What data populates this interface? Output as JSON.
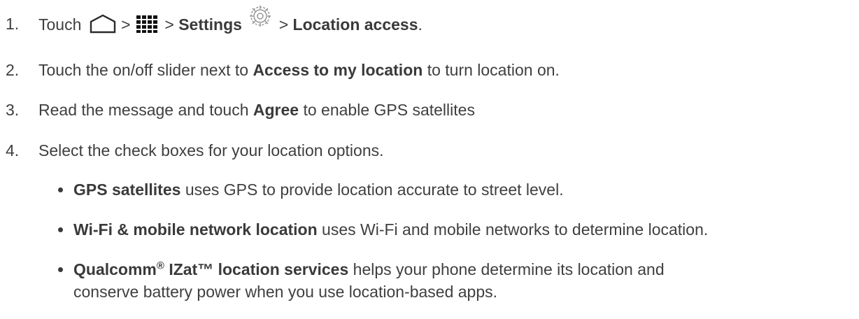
{
  "steps": [
    {
      "number": "1.",
      "touch": "Touch",
      "sep1": ">",
      "sep2": ">",
      "settings": "Settings",
      "sep3": ">",
      "location_access": "Location access",
      "end": ".",
      "icons": [
        "home-icon",
        "apps-grid-icon",
        "settings-gear-icon"
      ]
    },
    {
      "number": "2.",
      "pre": "Touch the on/off slider next to",
      "bold": "Access to my location",
      "post": "to turn location on."
    },
    {
      "number": "3.",
      "pre": "Read the message and touch",
      "bold": "Agree",
      "post": "to enable GPS satellites"
    },
    {
      "number": "4.",
      "text": "Select the check boxes for your location options."
    }
  ],
  "bullets": [
    {
      "bold": "GPS satellites",
      "post": "uses GPS to provide location accurate to street level."
    },
    {
      "bold": "Wi-Fi & mobile network location",
      "post": "uses Wi-Fi and mobile networks to determine location."
    },
    {
      "bold_a": "Qualcomm",
      "sup": "®",
      "bold_b": "IZat™ location services",
      "post": "helps your phone determine its location and",
      "line2": "conserve battery power when you use location-based apps."
    }
  ]
}
